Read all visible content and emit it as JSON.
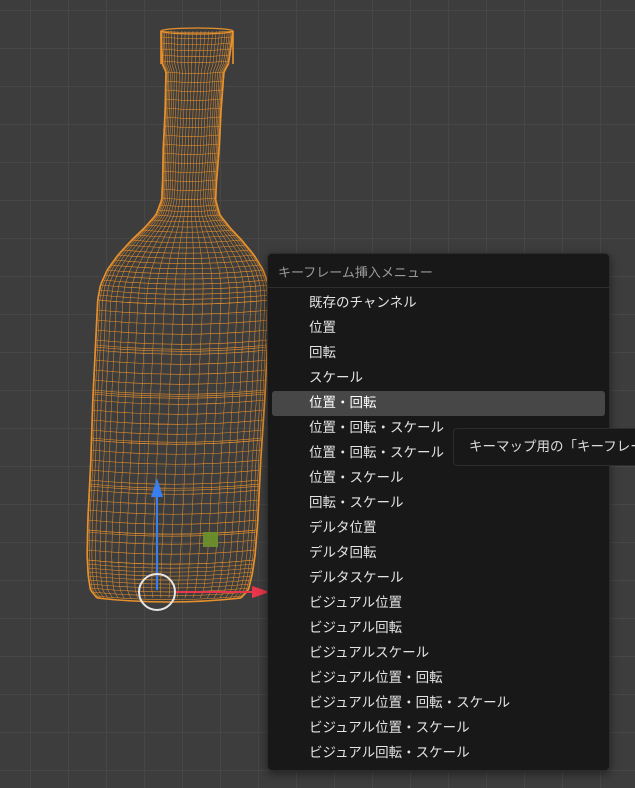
{
  "menu": {
    "title": "キーフレーム挿入メニュー",
    "items": [
      {
        "label": "既存のチャンネル"
      },
      {
        "label": "位置"
      },
      {
        "label": "回転"
      },
      {
        "label": "スケール"
      },
      {
        "label": "位置・回転",
        "active": true
      },
      {
        "label": "位置・回転・スケール"
      },
      {
        "label": "位置・回転・スケール"
      },
      {
        "label": "位置・スケール"
      },
      {
        "label": "回転・スケール"
      },
      {
        "label": "デルタ位置"
      },
      {
        "label": "デルタ回転"
      },
      {
        "label": "デルタスケール"
      },
      {
        "label": "ビジュアル位置"
      },
      {
        "label": "ビジュアル回転"
      },
      {
        "label": "ビジュアルスケール"
      },
      {
        "label": "ビジュアル位置・回転"
      },
      {
        "label": "ビジュアル位置・回転・スケール"
      },
      {
        "label": "ビジュアル位置・スケール"
      },
      {
        "label": "ビジュアル回転・スケール"
      }
    ]
  },
  "tooltip": {
    "text": "キーマップ用の「キーフレーム"
  },
  "colors": {
    "viewport_bg": "#3d3d3d",
    "grid": "#474747",
    "wireframe": "#e8912c",
    "gizmo_z": "#3a7ff0",
    "gizmo_x": "#e8374d",
    "origin_square": "#6c8f2c",
    "menu_bg": "#181818",
    "menu_highlight": "#474747"
  },
  "icons": {
    "gizmo_z_arrow": "arrow-up",
    "gizmo_x_arrow": "arrow-right",
    "gizmo_center": "circle"
  }
}
